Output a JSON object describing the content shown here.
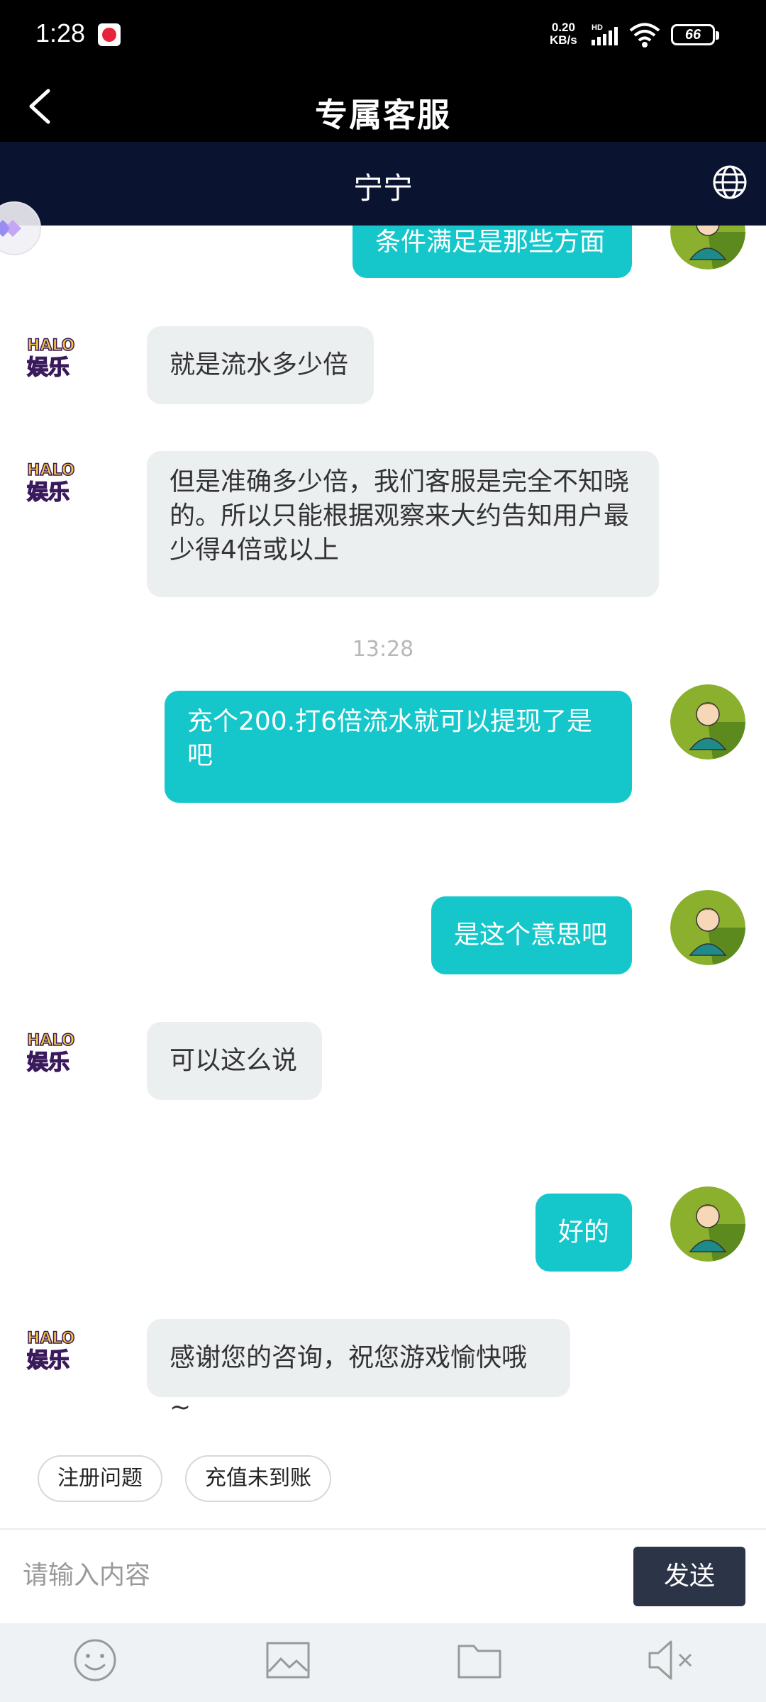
{
  "status_bar": {
    "time": "1:28",
    "net_speed_value": "0.20",
    "net_speed_unit": "KB/s",
    "hd_label": "HD",
    "battery": "66"
  },
  "header": {
    "title": "专属客服"
  },
  "subheader": {
    "agent_name": "宁宁"
  },
  "messages": [
    {
      "from": "user",
      "text": "条件满足是那些方面"
    },
    {
      "from": "agent",
      "text": "就是流水多少倍"
    },
    {
      "from": "agent",
      "text": "但是准确多少倍，我们客服是完全不知晓的。所以只能根据观察来大约告知用户最少得4倍或以上"
    },
    {
      "from": "user",
      "text": "充个200.打6倍流水就可以提现了是吧"
    },
    {
      "from": "user",
      "text": "是这个意思吧"
    },
    {
      "from": "agent",
      "text": "可以这么说"
    },
    {
      "from": "user",
      "text": "好的"
    },
    {
      "from": "agent",
      "text": "感谢您的咨询，祝您游戏愉快哦~"
    }
  ],
  "timestamp": "13:28",
  "agent_avatar": {
    "line1": "HALO",
    "line2": "娱乐"
  },
  "quick_replies": [
    "注册问题",
    "充值未到账"
  ],
  "input": {
    "placeholder": "请输入内容",
    "value": ""
  },
  "send_label": "发送",
  "toolbar_icons": [
    "emoji-icon",
    "image-icon",
    "folder-icon",
    "mute-icon"
  ],
  "colors": {
    "user_bubble": "#15c7cb",
    "agent_bubble": "#eceff0",
    "send_button": "#2c3448",
    "subheader_bg": "#0a1330"
  }
}
